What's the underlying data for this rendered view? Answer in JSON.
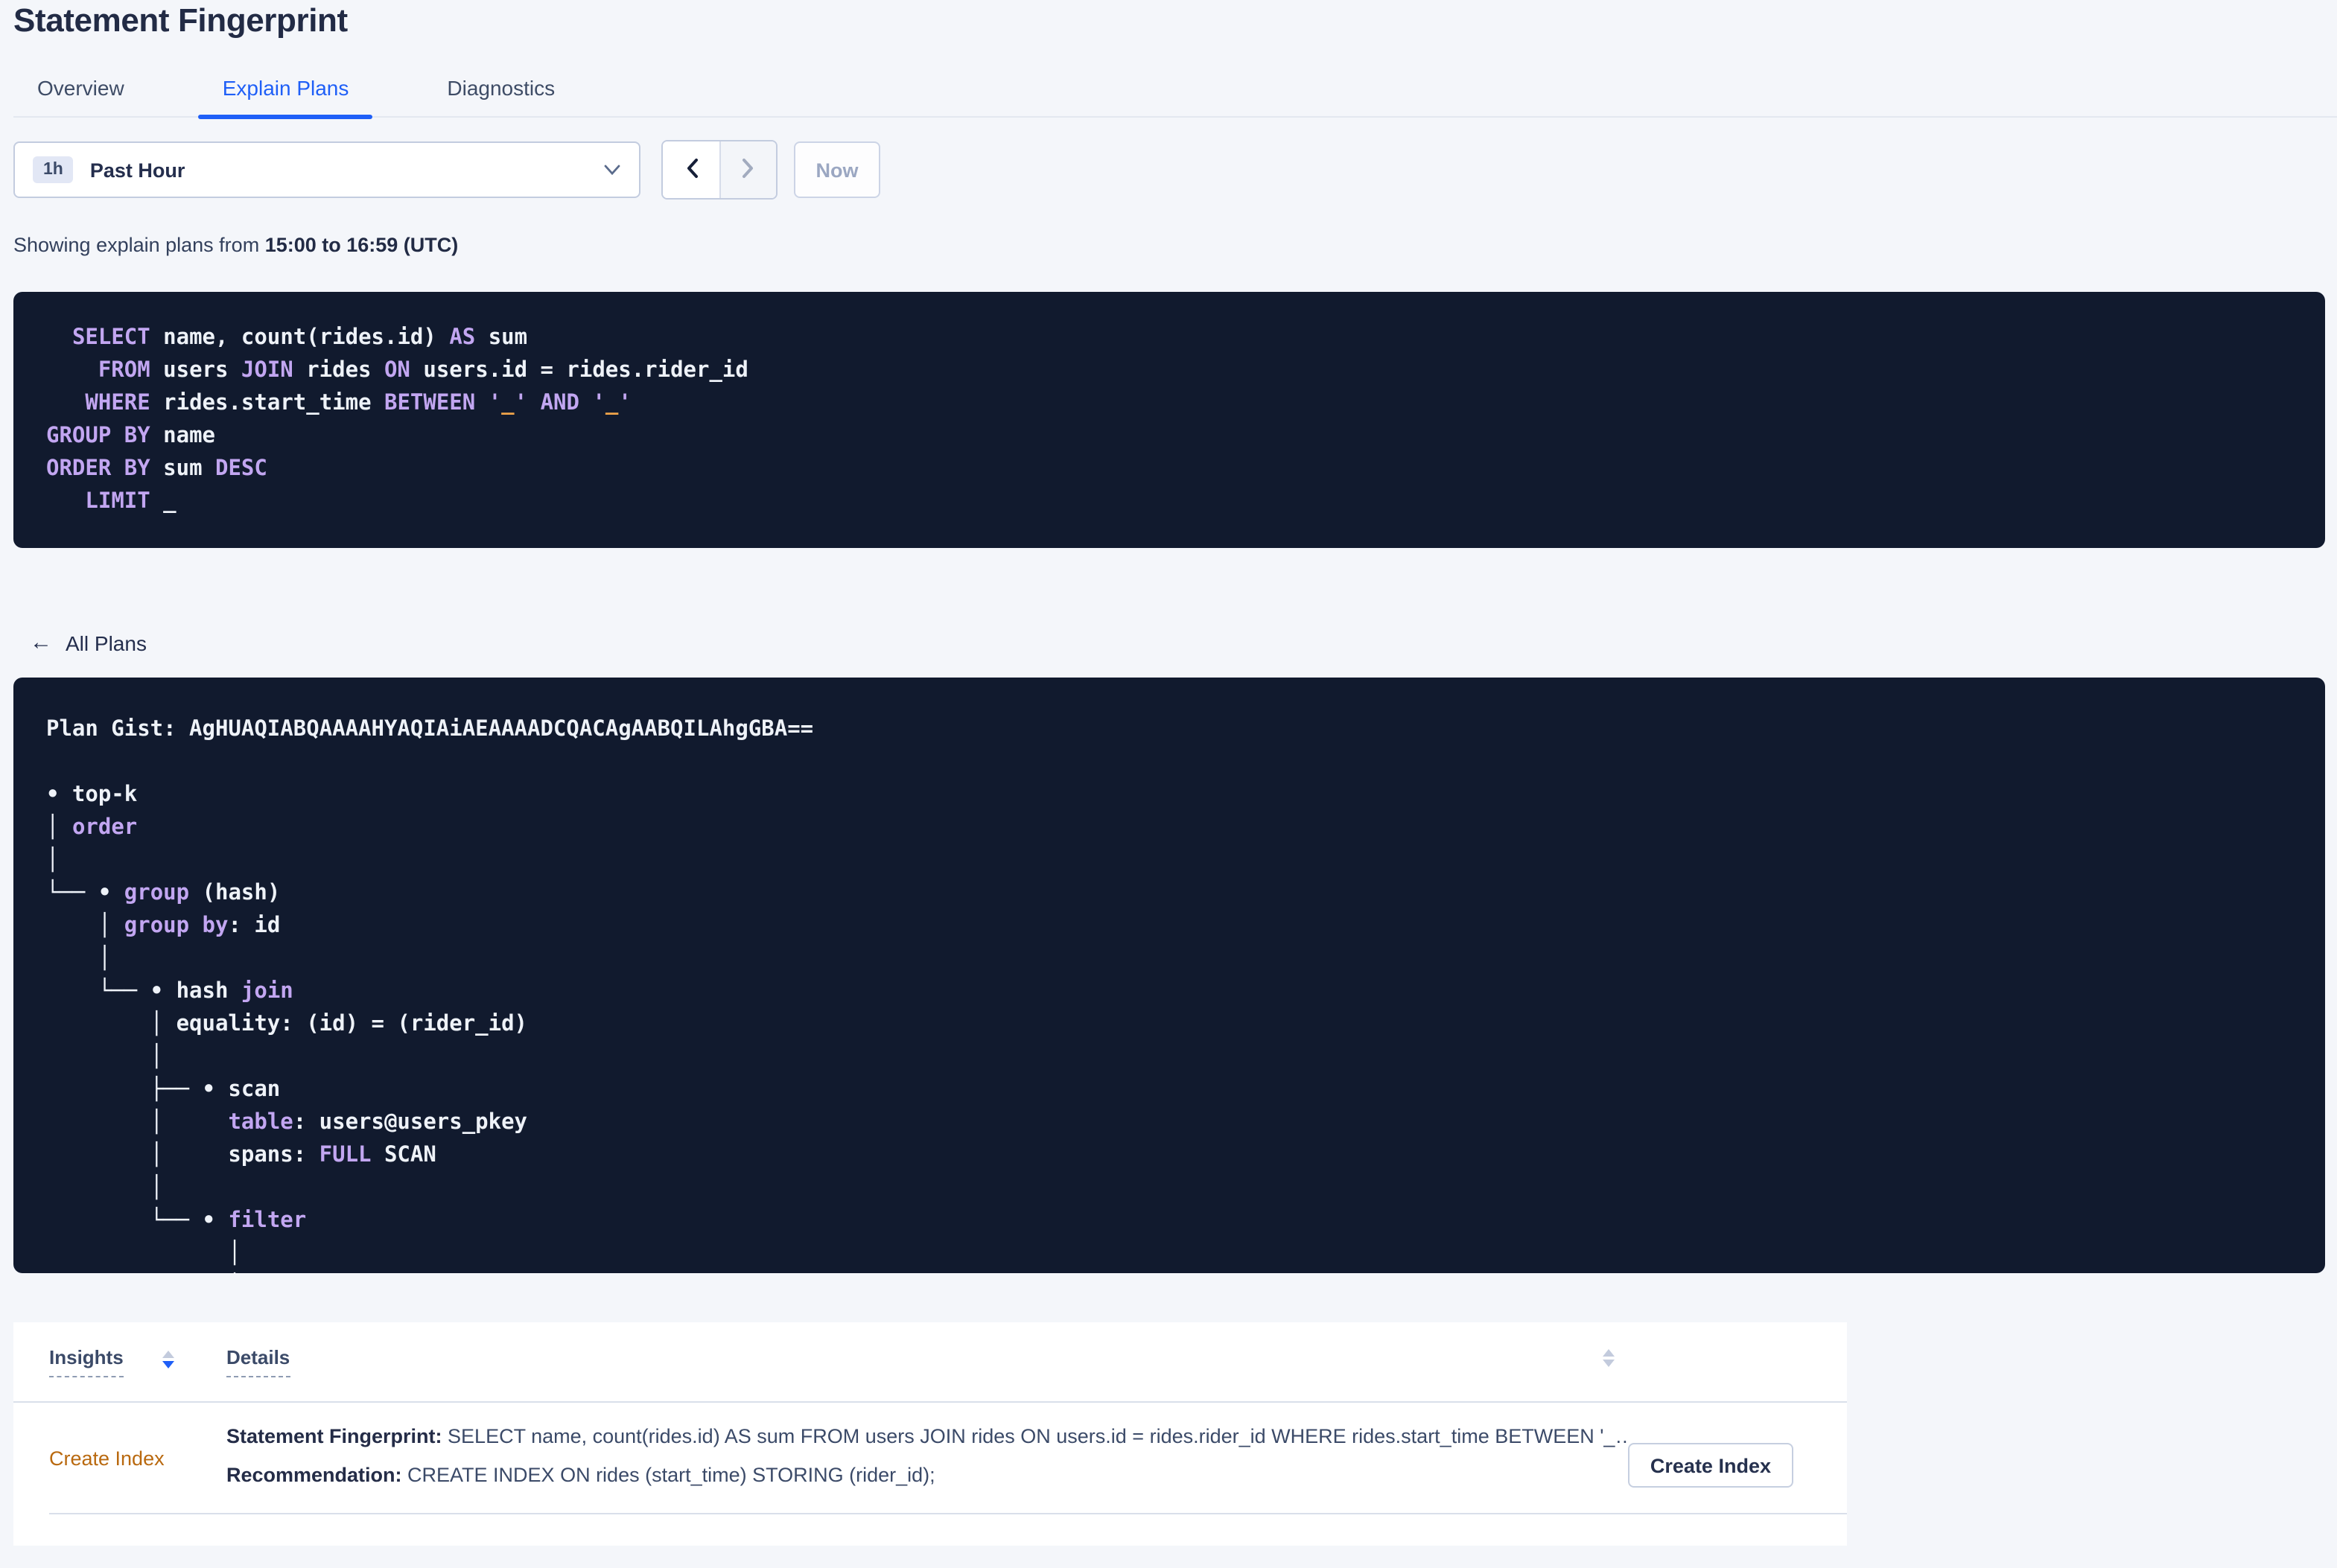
{
  "page": {
    "title": "Statement Fingerprint"
  },
  "tabs": {
    "items": [
      {
        "label": "Overview",
        "active": false
      },
      {
        "label": "Explain Plans",
        "active": true
      },
      {
        "label": "Diagnostics",
        "active": false
      }
    ]
  },
  "time_selector": {
    "badge": "1h",
    "label": "Past Hour",
    "now_label": "Now"
  },
  "showing": {
    "prefix": "Showing explain plans from ",
    "range": "15:00 to 16:59 (UTC)"
  },
  "sql_box": {
    "lines": [
      [
        [
          "w",
          "  "
        ],
        [
          "kw",
          "SELECT"
        ],
        [
          "w",
          " name, count(rides.id) "
        ],
        [
          "kw",
          "AS"
        ],
        [
          "w",
          " sum"
        ]
      ],
      [
        [
          "w",
          "    "
        ],
        [
          "kw",
          "FROM"
        ],
        [
          "w",
          " users "
        ],
        [
          "kw",
          "JOIN"
        ],
        [
          "w",
          " rides "
        ],
        [
          "kw",
          "ON"
        ],
        [
          "w",
          " users.id = rides.rider_id"
        ]
      ],
      [
        [
          "w",
          "   "
        ],
        [
          "kw",
          "WHERE"
        ],
        [
          "w",
          " rides.start_time "
        ],
        [
          "kw",
          "BETWEEN"
        ],
        [
          "w",
          " "
        ],
        [
          "kw",
          "'"
        ],
        [
          "ph",
          "_"
        ],
        [
          "kw",
          "'"
        ],
        [
          "w",
          " "
        ],
        [
          "kw",
          "AND"
        ],
        [
          "w",
          " "
        ],
        [
          "kw",
          "'"
        ],
        [
          "ph",
          "_"
        ],
        [
          "kw",
          "'"
        ]
      ],
      [
        [
          "kw",
          "GROUP BY"
        ],
        [
          "w",
          " name"
        ]
      ],
      [
        [
          "kw",
          "ORDER BY"
        ],
        [
          "w",
          " sum "
        ],
        [
          "kw",
          "DESC"
        ]
      ],
      [
        [
          "w",
          "   "
        ],
        [
          "kw",
          "LIMIT"
        ],
        [
          "w",
          " _"
        ]
      ]
    ]
  },
  "back_link": {
    "arrow": "←",
    "label": "All Plans"
  },
  "plan_box": {
    "lines": [
      [
        [
          "w",
          "Plan Gist: AgHUAQIABQAAAAHYAQIAiAEAAAADCQACAgAABQILAhgGBA=="
        ]
      ],
      [],
      [
        [
          "w",
          "• top-k"
        ]
      ],
      [
        [
          "w",
          "│ "
        ],
        [
          "kw",
          "order"
        ]
      ],
      [
        [
          "w",
          "│"
        ]
      ],
      [
        [
          "w",
          "└── • "
        ],
        [
          "kw",
          "group"
        ],
        [
          "w",
          " (hash)"
        ]
      ],
      [
        [
          "w",
          "    │ "
        ],
        [
          "kw",
          "group by"
        ],
        [
          "w",
          ": id"
        ]
      ],
      [
        [
          "w",
          "    │"
        ]
      ],
      [
        [
          "w",
          "    └── • hash "
        ],
        [
          "kw",
          "join"
        ]
      ],
      [
        [
          "w",
          "        │ equality: (id) = (rider_id)"
        ]
      ],
      [
        [
          "w",
          "        │"
        ]
      ],
      [
        [
          "w",
          "        ├── • scan"
        ]
      ],
      [
        [
          "w",
          "        │     "
        ],
        [
          "kw",
          "table"
        ],
        [
          "w",
          ": users@users_pkey"
        ]
      ],
      [
        [
          "w",
          "        │     spans: "
        ],
        [
          "kw",
          "FULL"
        ],
        [
          "w",
          " SCAN"
        ]
      ],
      [
        [
          "w",
          "        │"
        ]
      ],
      [
        [
          "w",
          "        └── • "
        ],
        [
          "kw",
          "filter"
        ]
      ],
      [
        [
          "w",
          "              │"
        ]
      ],
      [
        [
          "w",
          "              │"
        ]
      ]
    ]
  },
  "insights": {
    "columns": [
      "Insights",
      "Details"
    ],
    "rows": [
      {
        "insight": "Create Index",
        "fingerprint_label": "Statement Fingerprint:",
        "fingerprint": " SELECT name, count(rides.id) AS sum FROM users JOIN rides ON users.id = rides.rider_id WHERE rides.start_time BETWEEN '_…",
        "recommendation_label": "Recommendation:",
        "recommendation": " CREATE INDEX ON rides (start_time) STORING (rider_id);",
        "action": "Create Index"
      }
    ]
  }
}
